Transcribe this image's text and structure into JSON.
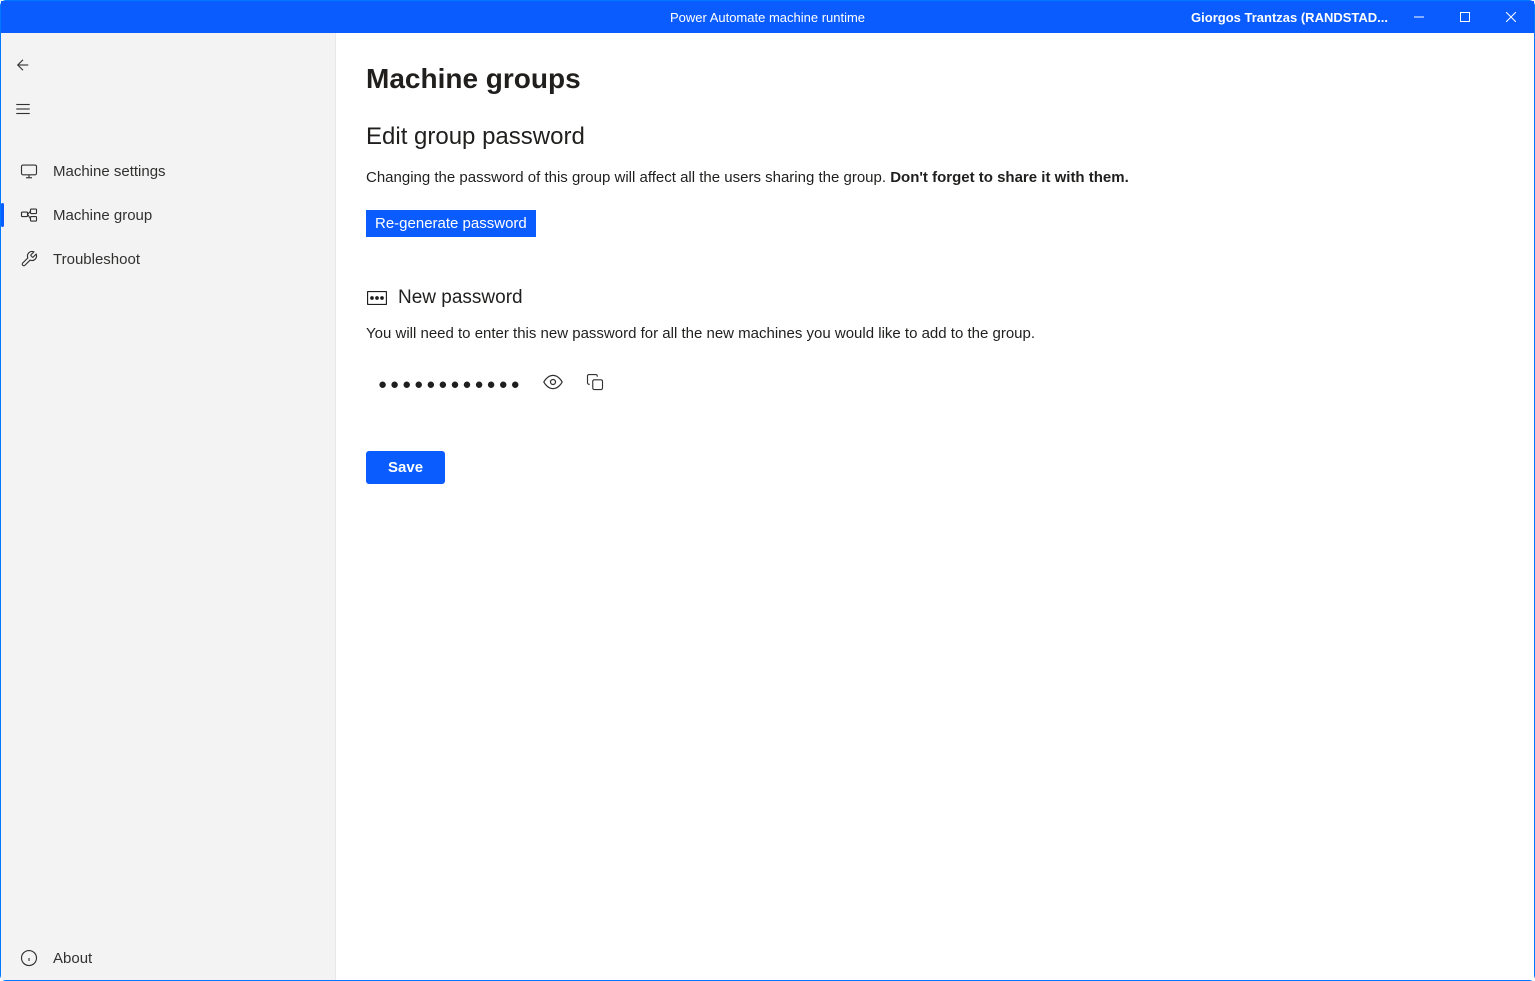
{
  "titlebar": {
    "title": "Power Automate machine runtime",
    "user": "Giorgos Trantzas (RANDSTAD..."
  },
  "sidebar": {
    "items": [
      {
        "label": "Machine settings"
      },
      {
        "label": "Machine group"
      },
      {
        "label": "Troubleshoot"
      }
    ],
    "about": "About"
  },
  "main": {
    "page_title": "Machine groups",
    "section_title": "Edit group password",
    "description_text": "Changing the password of this group will affect all the users sharing the group. ",
    "description_bold": "Don't forget to share it with them.",
    "regenerate_label": "Re-generate password",
    "new_password_label": "New password",
    "new_password_desc": "You will need to enter this new password for all the new machines you would like to add to the group.",
    "password_value": "●●●●●●●●●●●●",
    "save_label": "Save"
  }
}
